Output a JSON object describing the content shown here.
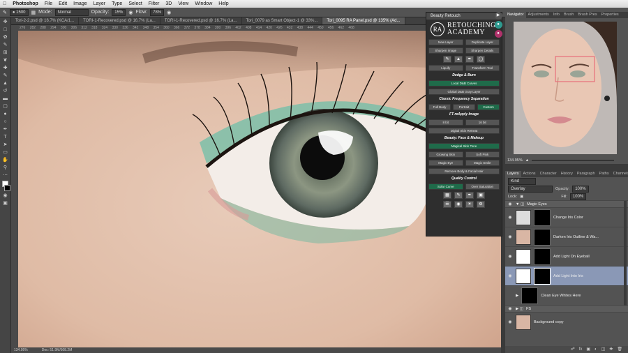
{
  "menubar": {
    "app": "Photoshop",
    "items": [
      "File",
      "Edit",
      "Image",
      "Layer",
      "Type",
      "Select",
      "Filter",
      "3D",
      "View",
      "Window",
      "Help"
    ]
  },
  "options": {
    "mode_label": "Mode:",
    "mode_value": "Normal",
    "opacity_label": "Opacity:",
    "opacity_value": "15%",
    "flow_label": "Flow:",
    "flow_value": "78%"
  },
  "tabs": [
    {
      "label": "Tori-2-2.psd @ 16.7% (KCA/1..."
    },
    {
      "label": "TORI-1-Recovered.psd @ 16.7% (La..."
    },
    {
      "label": "TORI-1-Recovered.psd @ 16.7% (La..."
    },
    {
      "label": "Tori_0079 as Smart Object-1 @ 33%..."
    },
    {
      "label": "Tori_0095 RA Panel.psd @ 135% (Ad..."
    }
  ],
  "title": "Tori_0095 RA Panel.psd @ 135% (Add Light Into Iris, Layer Mask/8) *",
  "ruler_ticks": "276 282 288 294 300 306 312 318 324 330 336 342 348 354 360 366 372 378 384 390 396 402 408 414 420 426 432 438 444 450 456 462 468",
  "status": {
    "zoom": "134.95%",
    "doc": "Doc: 51.9M/508.2M"
  },
  "retouch_panel": {
    "title": "Beauty Retouch",
    "logo_line1": "RETOUCHING",
    "logo_line2": "ACADEMY",
    "logo_badge": "RA",
    "rows1": [
      [
        "New Layer",
        "Duplicate Layer"
      ],
      [
        "Sharpen Image",
        "Sharpen Details"
      ]
    ],
    "rows2": [
      [
        "Liquify",
        "Transform Tool"
      ]
    ],
    "sec_dodge": "Dodge & Burn",
    "btn_local": "Local D&B Curves",
    "btn_global": "Global D&B Gray Layer",
    "sec_freq": "Classic Frequency Separation",
    "freq_btns": [
      "Full Body",
      "Portrait",
      "Custom"
    ],
    "sec_ft": "FT-reApply Image",
    "ft_btns": [
      "8 bit",
      "16 bit"
    ],
    "btn_digital": "Digital Skin Retreat",
    "sec_beauty": "Beauty: Face & Makeup",
    "btn_magic": "Magical Skin Tone",
    "beauty_rows": [
      [
        "Growing Skin",
        "Soft Pink"
      ],
      [
        "Magic Eye",
        "Magic Smile"
      ]
    ],
    "btn_remove": "Remove Body & Facial Hair",
    "sec_quality": "Quality Control",
    "quality_btns": [
      "Solar Curve",
      "Over Saturation"
    ]
  },
  "navigator": {
    "tabs": [
      "Navigator",
      "Adjustments",
      "Info",
      "Brush",
      "Brush Pres",
      "Properties"
    ],
    "zoom": "134.95%"
  },
  "layers": {
    "tabs": [
      "Layers",
      "Actions",
      "Character",
      "History",
      "Paragraph",
      "Paths",
      "Channels"
    ],
    "kind": "Kind",
    "blend": "Overlay",
    "opacity_label": "Opacity:",
    "opacity": "100%",
    "lock_label": "Lock:",
    "fill_label": "Fill:",
    "fill": "100%",
    "items": [
      {
        "name": "Magic Eyes",
        "type": "group"
      },
      {
        "name": "Change Iris Color",
        "type": "adj"
      },
      {
        "name": "Darken Iris Outline & Wa...",
        "type": "img"
      },
      {
        "name": "Add Light On Eyeball",
        "type": "adj"
      },
      {
        "name": "Add Light Into Iris",
        "type": "adj",
        "selected": true
      },
      {
        "name": "Clean Eye Whites Here",
        "type": "adj"
      },
      {
        "name": "FS",
        "type": "group"
      },
      {
        "name": "Background copy",
        "type": "img"
      }
    ]
  },
  "colors": {
    "accent_green": "#1f6b4a",
    "selected_layer": "#8a98b6"
  }
}
